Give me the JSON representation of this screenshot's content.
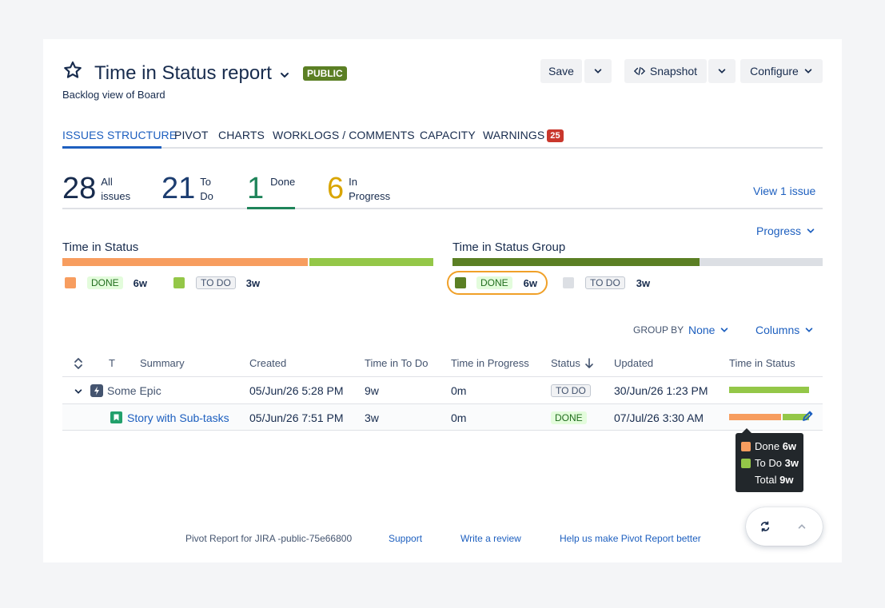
{
  "header": {
    "title": "Time in Status report",
    "visibility_badge": "PUBLIC",
    "subtitle": "Backlog view of Board",
    "save_label": "Save",
    "snapshot_label": "Snapshot",
    "configure_label": "Configure"
  },
  "tabs": [
    {
      "label": "ISSUES STRUCTURE",
      "active": true
    },
    {
      "label": "PIVOT"
    },
    {
      "label": "CHARTS"
    },
    {
      "label": "WORKLOGS / COMMENTS"
    },
    {
      "label": "CAPACITY"
    },
    {
      "label": "WARNINGS",
      "badge": "25"
    }
  ],
  "stats": [
    {
      "count": "28",
      "label_line1": "All",
      "label_line2": "issues",
      "color": "#172b4d"
    },
    {
      "count": "21",
      "label_line1": "To",
      "label_line2": "Do",
      "color": "#1c3d70"
    },
    {
      "count": "1",
      "label_line1": "Done",
      "label_line2": "",
      "color": "#1f845a",
      "active": true
    },
    {
      "count": "6",
      "label_line1": "In",
      "label_line2": "Progress",
      "color": "#d9a500"
    }
  ],
  "view_link": "View 1 issue",
  "progress_dropdown": "Progress",
  "time_in_status": {
    "title": "Time in Status",
    "segments": [
      {
        "status": "DONE",
        "duration": "6w",
        "fraction": 0.667,
        "color": "#f79d5f"
      },
      {
        "status": "TO DO",
        "duration": "3w",
        "fraction": 0.333,
        "color": "#94c748"
      }
    ]
  },
  "time_in_status_group": {
    "title": "Time in Status Group",
    "segments": [
      {
        "status": "DONE",
        "duration": "6w",
        "fraction": 0.667,
        "color": "#5b7f24"
      },
      {
        "status": "TO DO",
        "duration": "3w",
        "fraction": 0.333,
        "color": "#dcdfe4"
      }
    ]
  },
  "controls": {
    "group_by_label": "GROUP BY",
    "group_by_value": "None",
    "columns_label": "Columns"
  },
  "table": {
    "headers": {
      "type": "T",
      "summary": "Summary",
      "created": "Created",
      "time_todo": "Time in To Do",
      "time_progress": "Time in Progress",
      "status": "Status",
      "updated": "Updated",
      "time_status": "Time in Status"
    },
    "rows": [
      {
        "summary": "Some Epic",
        "created": "05/Jun/26 5:28 PM",
        "time_todo": "9w",
        "time_progress": "0m",
        "status": "TO DO",
        "updated": "30/Jun/26 1:23 PM",
        "bar": [
          {
            "fraction": 1.0,
            "color": "#94c748"
          }
        ]
      },
      {
        "summary": "Story with Sub-tasks",
        "created": "05/Jun/26 7:51 PM",
        "time_todo": "3w",
        "time_progress": "0m",
        "status": "DONE",
        "updated": "07/Jul/26 3:30 AM",
        "bar": [
          {
            "fraction": 0.667,
            "color": "#f79d5f"
          },
          {
            "fraction": 0.333,
            "color": "#94c748"
          }
        ]
      }
    ]
  },
  "tooltip": {
    "done_label": "Done",
    "done_value": "6w",
    "todo_label": "To Do",
    "todo_value": "3w",
    "total_label": "Total",
    "total_value": "9w"
  },
  "footer": {
    "product": "Pivot Report for JIRA -public-75e66800",
    "support": "Support",
    "review": "Write a review",
    "feedback": "Help us make Pivot Report better"
  }
}
